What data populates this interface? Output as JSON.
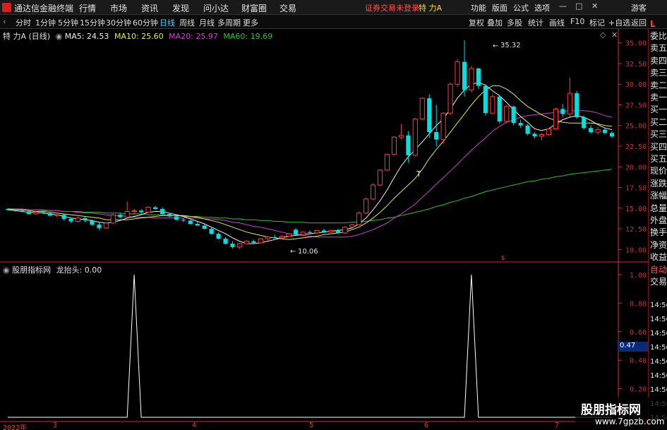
{
  "app": {
    "title": "通达信金融终端"
  },
  "menu": [
    "行情",
    "市场",
    "资讯",
    "发现",
    "问小达",
    "财富圈",
    "交易"
  ],
  "login_status": "证券交易未登录",
  "stock_name": "特 力A",
  "right_menu": [
    "功能",
    "版面",
    "公式",
    "选项"
  ],
  "user_label": "游客",
  "periods": [
    "分时",
    "1分钟",
    "5分钟",
    "15分钟",
    "30分钟",
    "60分钟",
    "日线",
    "周线",
    "月线",
    "多周期",
    "更多"
  ],
  "active_period": "日线",
  "right_tools": [
    "复权",
    "叠加",
    "多股",
    "统计",
    "画线",
    "F10",
    "标记",
    "+自选",
    "返回"
  ],
  "chart_header": {
    "title": "特 力A (日线)",
    "ma5": "MA5: 24.53",
    "ma10": "MA10: 25.60",
    "ma20": "MA20: 25.97",
    "ma60": "MA60: 19.69"
  },
  "colors": {
    "up": "#ff3c3c",
    "down": "#00e0e0",
    "ma5": "#f0f0f0",
    "ma10": "#e8e84a",
    "ma20": "#d040d0",
    "ma60": "#30c030",
    "axis": "#d03030",
    "indicator": "#ffffff"
  },
  "price_axis": [
    "35.00",
    "32.50",
    "30.00",
    "27.50",
    "25.00",
    "22.50",
    "20.00",
    "17.50",
    "15.00",
    "12.50",
    "10.00"
  ],
  "annotations": {
    "high": "35.32",
    "low": "10.06",
    "marker_t": "T",
    "marker_s": "s"
  },
  "indicator": {
    "label": "股朋指标网",
    "name": "龙抬头: 0.00",
    "axis": [
      "1.00",
      "0.80",
      "0.60",
      "0.40",
      "0.20"
    ],
    "current": "0.47"
  },
  "time_axis": [
    "2022年",
    "3",
    "4",
    "5",
    "6",
    "7"
  ],
  "side_panel": [
    "委比",
    "卖五",
    "卖四",
    "卖三",
    "卖二",
    "卖一",
    "买一",
    "买二",
    "买三",
    "买四",
    "买五",
    "现价",
    "涨跌",
    "涨幅",
    "总量",
    "外盘",
    "换手",
    "净资",
    "收益",
    "自动",
    "交易"
  ],
  "side_times": [
    "14:56",
    "14:56",
    "14:56",
    "14:56",
    "14:56",
    "14:56",
    "14:56",
    "14:56",
    "14:56"
  ],
  "side_top": "L",
  "watermark": {
    "title": "股朋指标网",
    "url": "www.7gpzb.com"
  },
  "chart_data": {
    "type": "candlestick",
    "ylim": [
      9,
      36
    ],
    "grid": false,
    "candles": [
      {
        "o": 14.9,
        "h": 15.0,
        "l": 14.7,
        "c": 14.8
      },
      {
        "o": 14.8,
        "h": 14.9,
        "l": 14.6,
        "c": 14.7
      },
      {
        "o": 14.7,
        "h": 14.8,
        "l": 14.5,
        "c": 14.6
      },
      {
        "o": 14.6,
        "h": 14.7,
        "l": 14.2,
        "c": 14.3
      },
      {
        "o": 14.3,
        "h": 14.6,
        "l": 14.2,
        "c": 14.5
      },
      {
        "o": 14.5,
        "h": 14.6,
        "l": 14.3,
        "c": 14.4
      },
      {
        "o": 14.4,
        "h": 14.5,
        "l": 14.0,
        "c": 14.1
      },
      {
        "o": 14.1,
        "h": 14.3,
        "l": 13.9,
        "c": 14.2
      },
      {
        "o": 14.2,
        "h": 14.3,
        "l": 13.5,
        "c": 13.7
      },
      {
        "o": 13.7,
        "h": 13.9,
        "l": 13.2,
        "c": 13.4
      },
      {
        "o": 13.4,
        "h": 13.9,
        "l": 13.3,
        "c": 13.8
      },
      {
        "o": 13.8,
        "h": 13.9,
        "l": 13.3,
        "c": 13.5
      },
      {
        "o": 13.5,
        "h": 13.6,
        "l": 12.9,
        "c": 13.0
      },
      {
        "o": 13.0,
        "h": 13.3,
        "l": 12.4,
        "c": 12.6
      },
      {
        "o": 12.6,
        "h": 13.3,
        "l": 12.5,
        "c": 13.2
      },
      {
        "o": 13.2,
        "h": 14.3,
        "l": 13.1,
        "c": 14.2
      },
      {
        "o": 14.2,
        "h": 14.4,
        "l": 13.8,
        "c": 13.9
      },
      {
        "o": 13.9,
        "h": 15.8,
        "l": 13.8,
        "c": 14.6
      },
      {
        "o": 14.6,
        "h": 14.9,
        "l": 14.2,
        "c": 14.7
      },
      {
        "o": 14.7,
        "h": 14.9,
        "l": 14.4,
        "c": 14.5
      },
      {
        "o": 14.5,
        "h": 15.2,
        "l": 14.4,
        "c": 15.1
      },
      {
        "o": 15.1,
        "h": 15.3,
        "l": 14.8,
        "c": 14.9
      },
      {
        "o": 14.9,
        "h": 15.1,
        "l": 14.2,
        "c": 14.3
      },
      {
        "o": 14.3,
        "h": 14.4,
        "l": 13.9,
        "c": 14.0
      },
      {
        "o": 14.0,
        "h": 14.1,
        "l": 13.5,
        "c": 13.6
      },
      {
        "o": 13.6,
        "h": 13.8,
        "l": 13.3,
        "c": 13.5
      },
      {
        "o": 13.5,
        "h": 13.6,
        "l": 13.0,
        "c": 13.1
      },
      {
        "o": 13.1,
        "h": 13.4,
        "l": 12.8,
        "c": 12.9
      },
      {
        "o": 12.9,
        "h": 13.0,
        "l": 12.4,
        "c": 12.5
      },
      {
        "o": 12.5,
        "h": 12.7,
        "l": 11.8,
        "c": 11.9
      },
      {
        "o": 11.9,
        "h": 12.1,
        "l": 11.2,
        "c": 11.3
      },
      {
        "o": 11.3,
        "h": 11.5,
        "l": 10.6,
        "c": 10.7
      },
      {
        "o": 10.7,
        "h": 11.0,
        "l": 10.1,
        "c": 10.3
      },
      {
        "o": 10.3,
        "h": 10.8,
        "l": 10.06,
        "c": 10.7
      },
      {
        "o": 10.7,
        "h": 11.1,
        "l": 10.6,
        "c": 11.0
      },
      {
        "o": 11.0,
        "h": 11.2,
        "l": 10.7,
        "c": 10.8
      },
      {
        "o": 10.8,
        "h": 11.4,
        "l": 10.7,
        "c": 11.3
      },
      {
        "o": 11.3,
        "h": 11.6,
        "l": 11.1,
        "c": 11.5
      },
      {
        "o": 11.5,
        "h": 11.8,
        "l": 11.3,
        "c": 11.4
      },
      {
        "o": 11.4,
        "h": 11.7,
        "l": 11.2,
        "c": 11.6
      },
      {
        "o": 11.6,
        "h": 12.0,
        "l": 11.5,
        "c": 11.9
      },
      {
        "o": 12.4,
        "h": 12.6,
        "l": 11.7,
        "c": 11.8
      },
      {
        "o": 11.8,
        "h": 12.2,
        "l": 11.7,
        "c": 12.1
      },
      {
        "o": 12.1,
        "h": 12.3,
        "l": 11.9,
        "c": 12.0
      },
      {
        "o": 12.0,
        "h": 12.4,
        "l": 11.9,
        "c": 12.3
      },
      {
        "o": 12.3,
        "h": 12.5,
        "l": 12.0,
        "c": 12.1
      },
      {
        "o": 12.1,
        "h": 12.4,
        "l": 12.0,
        "c": 12.3
      },
      {
        "o": 12.3,
        "h": 12.5,
        "l": 11.9,
        "c": 12.0
      },
      {
        "o": 12.0,
        "h": 12.8,
        "l": 11.9,
        "c": 12.7
      },
      {
        "o": 12.7,
        "h": 13.1,
        "l": 12.6,
        "c": 13.0
      },
      {
        "o": 13.0,
        "h": 14.6,
        "l": 12.9,
        "c": 14.4
      },
      {
        "o": 14.4,
        "h": 16.3,
        "l": 14.3,
        "c": 16.1
      },
      {
        "o": 16.1,
        "h": 18.0,
        "l": 16.0,
        "c": 17.8
      },
      {
        "o": 17.8,
        "h": 19.7,
        "l": 17.7,
        "c": 19.6
      },
      {
        "o": 19.6,
        "h": 21.6,
        "l": 19.5,
        "c": 21.5
      },
      {
        "o": 21.5,
        "h": 23.7,
        "l": 21.4,
        "c": 23.6
      },
      {
        "o": 23.6,
        "h": 25.2,
        "l": 23.3,
        "c": 23.8
      },
      {
        "o": 23.8,
        "h": 24.3,
        "l": 20.5,
        "c": 21.4
      },
      {
        "o": 21.4,
        "h": 25.9,
        "l": 21.3,
        "c": 25.8
      },
      {
        "o": 25.8,
        "h": 28.4,
        "l": 25.7,
        "c": 28.3
      },
      {
        "o": 28.3,
        "h": 28.8,
        "l": 23.5,
        "c": 24.2
      },
      {
        "o": 24.2,
        "h": 27.5,
        "l": 22.5,
        "c": 23.3
      },
      {
        "o": 23.3,
        "h": 26.6,
        "l": 22.8,
        "c": 26.5
      },
      {
        "o": 26.5,
        "h": 30.2,
        "l": 26.3,
        "c": 30.0
      },
      {
        "o": 30.0,
        "h": 33.0,
        "l": 29.7,
        "c": 32.7
      },
      {
        "o": 32.7,
        "h": 35.32,
        "l": 28.5,
        "c": 29.3
      },
      {
        "o": 29.3,
        "h": 32.2,
        "l": 29.0,
        "c": 31.9
      },
      {
        "o": 31.9,
        "h": 32.0,
        "l": 29.4,
        "c": 29.8
      },
      {
        "o": 29.8,
        "h": 30.0,
        "l": 26.2,
        "c": 26.5
      },
      {
        "o": 26.5,
        "h": 28.8,
        "l": 26.4,
        "c": 28.5
      },
      {
        "o": 28.5,
        "h": 28.7,
        "l": 25.2,
        "c": 25.5
      },
      {
        "o": 25.5,
        "h": 27.5,
        "l": 25.3,
        "c": 27.3
      },
      {
        "o": 27.3,
        "h": 27.4,
        "l": 25.0,
        "c": 25.3
      },
      {
        "o": 25.3,
        "h": 25.7,
        "l": 24.7,
        "c": 25.0
      },
      {
        "o": 25.0,
        "h": 25.2,
        "l": 23.8,
        "c": 24.0
      },
      {
        "o": 24.0,
        "h": 24.2,
        "l": 23.4,
        "c": 23.7
      },
      {
        "o": 23.7,
        "h": 24.1,
        "l": 23.2,
        "c": 23.9
      },
      {
        "o": 23.9,
        "h": 24.7,
        "l": 23.8,
        "c": 24.6
      },
      {
        "o": 24.6,
        "h": 27.2,
        "l": 24.5,
        "c": 27.0
      },
      {
        "o": 27.0,
        "h": 27.6,
        "l": 26.0,
        "c": 26.4
      },
      {
        "o": 26.4,
        "h": 30.8,
        "l": 26.0,
        "c": 28.9
      },
      {
        "o": 28.9,
        "h": 29.2,
        "l": 25.8,
        "c": 26.0
      },
      {
        "o": 26.0,
        "h": 26.2,
        "l": 24.5,
        "c": 24.7
      },
      {
        "o": 24.7,
        "h": 25.0,
        "l": 24.0,
        "c": 24.2
      },
      {
        "o": 24.2,
        "h": 24.8,
        "l": 23.9,
        "c": 24.5
      },
      {
        "o": 24.5,
        "h": 24.7,
        "l": 23.9,
        "c": 24.1
      },
      {
        "o": 24.1,
        "h": 24.3,
        "l": 23.5,
        "c": 23.7
      }
    ],
    "ma5": [
      14.8,
      14.7,
      14.6,
      14.5,
      14.5,
      14.4,
      14.3,
      14.2,
      14.0,
      13.8,
      13.7,
      13.6,
      13.5,
      13.3,
      13.2,
      13.3,
      13.5,
      13.8,
      14.0,
      14.2,
      14.5,
      14.6,
      14.6,
      14.4,
      14.2,
      14.0,
      13.7,
      13.4,
      13.1,
      12.7,
      12.3,
      11.9,
      11.4,
      11.0,
      10.7,
      10.7,
      10.8,
      11.0,
      11.2,
      11.4,
      11.6,
      11.7,
      11.8,
      11.9,
      12.0,
      12.1,
      12.2,
      12.3,
      12.4,
      12.6,
      13.1,
      13.8,
      14.8,
      15.9,
      17.2,
      18.7,
      20.1,
      21.2,
      22.1,
      23.0,
      24.0,
      25.0,
      25.8,
      27.0,
      28.3,
      29.3,
      30.0,
      30.2,
      29.9,
      29.2,
      28.6,
      27.8,
      26.9,
      26.1,
      25.4,
      24.6,
      24.4,
      24.6,
      25.2,
      25.7,
      26.0,
      26.2,
      26.0,
      25.6,
      25.1,
      24.7,
      24.5
    ],
    "ma10": [
      14.9,
      14.8,
      14.8,
      14.7,
      14.6,
      14.6,
      14.5,
      14.4,
      14.3,
      14.2,
      14.1,
      14.0,
      13.9,
      13.8,
      13.6,
      13.6,
      13.6,
      13.6,
      13.7,
      13.8,
      13.9,
      14.0,
      14.1,
      14.1,
      14.1,
      14.1,
      14.0,
      13.9,
      13.7,
      13.5,
      13.3,
      13.0,
      12.7,
      12.4,
      12.1,
      11.9,
      11.7,
      11.5,
      11.4,
      11.3,
      11.2,
      11.3,
      11.4,
      11.5,
      11.6,
      11.8,
      11.9,
      12.0,
      12.1,
      12.4,
      12.7,
      13.2,
      13.8,
      14.5,
      15.3,
      16.2,
      17.0,
      17.8,
      18.6,
      19.7,
      21.0,
      22.1,
      23.1,
      24.2,
      25.3,
      26.4,
      27.5,
      28.5,
      29.3,
      29.8,
      29.8,
      29.4,
      28.8,
      28.0,
      27.3,
      26.8,
      26.3,
      25.9,
      25.6,
      25.4,
      25.3,
      25.3,
      25.3,
      25.3,
      25.2,
      25.0,
      24.9
    ],
    "ma20": [
      14.9,
      14.9,
      14.9,
      14.8,
      14.8,
      14.8,
      14.7,
      14.7,
      14.6,
      14.6,
      14.5,
      14.4,
      14.4,
      14.3,
      14.2,
      14.1,
      14.1,
      14.0,
      13.9,
      13.9,
      13.9,
      13.8,
      13.8,
      13.8,
      13.8,
      13.8,
      13.8,
      13.8,
      13.7,
      13.7,
      13.6,
      13.5,
      13.3,
      13.2,
      13.0,
      12.8,
      12.7,
      12.5,
      12.3,
      12.1,
      11.9,
      11.8,
      11.7,
      11.6,
      11.5,
      11.5,
      11.5,
      11.5,
      11.5,
      11.6,
      11.8,
      12.1,
      12.4,
      12.8,
      13.2,
      13.8,
      14.3,
      14.9,
      15.5,
      16.3,
      17.1,
      17.9,
      18.7,
      19.5,
      20.3,
      21.2,
      22.0,
      22.8,
      23.5,
      24.3,
      24.9,
      25.4,
      25.7,
      26.0,
      26.2,
      26.3,
      26.4,
      26.5,
      26.6,
      26.7,
      26.8,
      26.8,
      26.8,
      26.7,
      26.5,
      26.2,
      26.0
    ],
    "ma60": [
      14.9,
      14.9,
      14.8,
      14.8,
      14.8,
      14.7,
      14.7,
      14.7,
      14.6,
      14.6,
      14.6,
      14.5,
      14.5,
      14.5,
      14.4,
      14.4,
      14.4,
      14.3,
      14.3,
      14.3,
      14.2,
      14.2,
      14.2,
      14.1,
      14.1,
      14.0,
      14.0,
      14.0,
      13.9,
      13.9,
      13.8,
      13.8,
      13.7,
      13.7,
      13.6,
      13.6,
      13.5,
      13.5,
      13.4,
      13.4,
      13.3,
      13.3,
      13.3,
      13.2,
      13.2,
      13.2,
      13.2,
      13.2,
      13.2,
      13.3,
      13.3,
      13.4,
      13.5,
      13.6,
      13.8,
      13.9,
      14.1,
      14.3,
      14.5,
      14.7,
      14.9,
      15.2,
      15.4,
      15.7,
      15.9,
      16.2,
      16.4,
      16.7,
      17.0,
      17.2,
      17.4,
      17.6,
      17.8,
      18.0,
      18.2,
      18.3,
      18.5,
      18.6,
      18.8,
      18.9,
      19.1,
      19.2,
      19.3,
      19.4,
      19.5,
      19.6,
      19.7
    ],
    "indicator_values": [
      0,
      0,
      0,
      0,
      0,
      0,
      0,
      0,
      0,
      0,
      0,
      0,
      0,
      0,
      0,
      0,
      0,
      0,
      1,
      0,
      0,
      0,
      0,
      0,
      0,
      0,
      0,
      0,
      0,
      0,
      0,
      0,
      0,
      0,
      0,
      0,
      0,
      0,
      0,
      0,
      0,
      0,
      0,
      0,
      0,
      0,
      0,
      0,
      0,
      0,
      0,
      0,
      0,
      0,
      0,
      0,
      0,
      0,
      0,
      0,
      0,
      0,
      0,
      0,
      0,
      0,
      1,
      0,
      0,
      0,
      0,
      0,
      0,
      0,
      0,
      0,
      0,
      0,
      0,
      0,
      0,
      0,
      0,
      0,
      0,
      0,
      0
    ]
  }
}
